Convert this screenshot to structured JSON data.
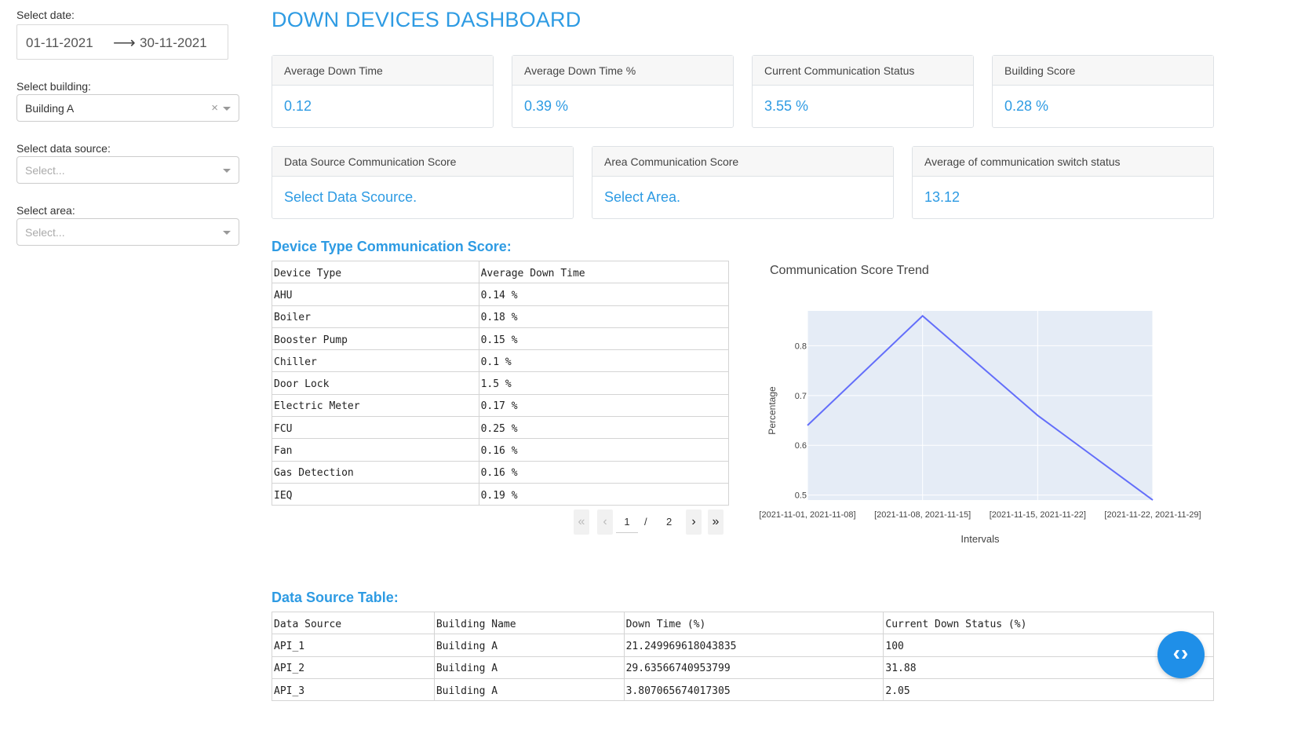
{
  "sidebar": {
    "date_label": "Select date:",
    "start_date": "01-11-2021",
    "end_date": "30-11-2021",
    "building_label": "Select building:",
    "building_value": "Building A",
    "data_source_label": "Select data source:",
    "data_source_placeholder": "Select...",
    "area_label": "Select area:",
    "area_placeholder": "Select..."
  },
  "title": "DOWN DEVICES DASHBOARD",
  "cards_row1": [
    {
      "title": "Average Down Time",
      "value": "0.12"
    },
    {
      "title": "Average Down Time %",
      "value": "0.39 %"
    },
    {
      "title": "Current Communication Status",
      "value": "3.55 %"
    },
    {
      "title": "Building Score",
      "value": "0.28 %"
    }
  ],
  "cards_row2": [
    {
      "title": "Data Source Communication Score",
      "value": "Select Data Scource."
    },
    {
      "title": "Area Communication Score",
      "value": "Select Area."
    },
    {
      "title": "Average of communication switch status",
      "value": "13.12"
    }
  ],
  "device_table": {
    "title": "Device Type Communication Score:",
    "headers": [
      "Device Type",
      "Average Down Time"
    ],
    "rows": [
      [
        "AHU",
        "0.14 %"
      ],
      [
        "Boiler",
        "0.18 %"
      ],
      [
        "Booster Pump",
        "0.15 %"
      ],
      [
        "Chiller",
        "0.1 %"
      ],
      [
        "Door Lock",
        "1.5 %"
      ],
      [
        "Electric Meter",
        "0.17 %"
      ],
      [
        "FCU",
        "0.25 %"
      ],
      [
        "Fan",
        "0.16 %"
      ],
      [
        "Gas Detection",
        "0.16 %"
      ],
      [
        "IEQ",
        "0.19 %"
      ]
    ],
    "pager": {
      "current": "1",
      "separator": "/",
      "total": "2"
    }
  },
  "chart_data": {
    "type": "line",
    "title": "Communication Score Trend",
    "xlabel": "Intervals",
    "ylabel": "Percentage",
    "categories": [
      "[2021-11-01, 2021-11-08]",
      "[2021-11-08, 2021-11-15]",
      "[2021-11-15, 2021-11-22]",
      "[2021-11-22, 2021-11-29]"
    ],
    "values": [
      0.64,
      0.86,
      0.66,
      0.49
    ],
    "yticks": [
      0.5,
      0.6,
      0.7,
      0.8
    ],
    "ylim": [
      0.49,
      0.87
    ],
    "grid": true,
    "line_color": "#636efa",
    "plot_bg": "#e5ecf6"
  },
  "data_source_table": {
    "title": "Data Source Table:",
    "headers": [
      "Data Source",
      "Building Name",
      "Down Time (%)",
      "Current Down Status (%)"
    ],
    "rows": [
      [
        "API_1",
        "Building A",
        "21.249969618043835",
        "100"
      ],
      [
        "API_2",
        "Building A",
        "29.63566740953799",
        "31.88"
      ],
      [
        "API_3",
        "Building A",
        "3.807065674017305",
        "2.05"
      ]
    ]
  },
  "fab": {
    "label": "‹›"
  },
  "colors": {
    "accent": "#2e9be3",
    "fab": "#1f8fe8"
  }
}
